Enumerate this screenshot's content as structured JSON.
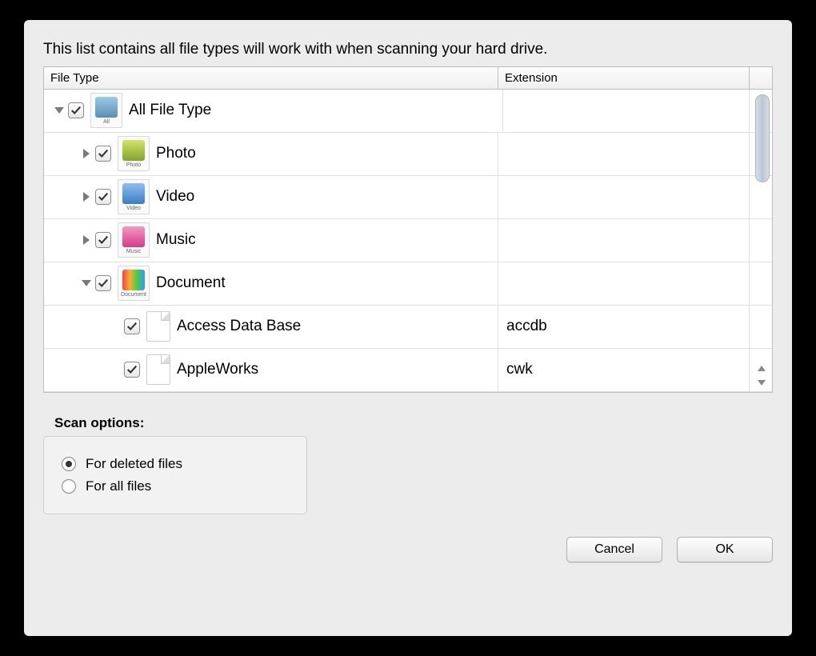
{
  "description": "This list contains all file types will work with when scanning your hard drive.",
  "columns": {
    "file_type": "File Type",
    "extension": "Extension"
  },
  "tree": {
    "all": {
      "label": "All File Type",
      "icon_caption": "All"
    },
    "photo": {
      "label": "Photo",
      "icon_caption": "Photo"
    },
    "video": {
      "label": "Video",
      "icon_caption": "Video"
    },
    "music": {
      "label": "Music",
      "icon_caption": "Music"
    },
    "document": {
      "label": "Document",
      "icon_caption": "Document"
    },
    "access": {
      "label": "Access Data Base",
      "ext": "accdb"
    },
    "appleworks": {
      "label": "AppleWorks",
      "ext": "cwk"
    }
  },
  "scan": {
    "title": "Scan options:",
    "deleted": "For deleted files",
    "all": "For all files"
  },
  "buttons": {
    "cancel": "Cancel",
    "ok": "OK"
  }
}
